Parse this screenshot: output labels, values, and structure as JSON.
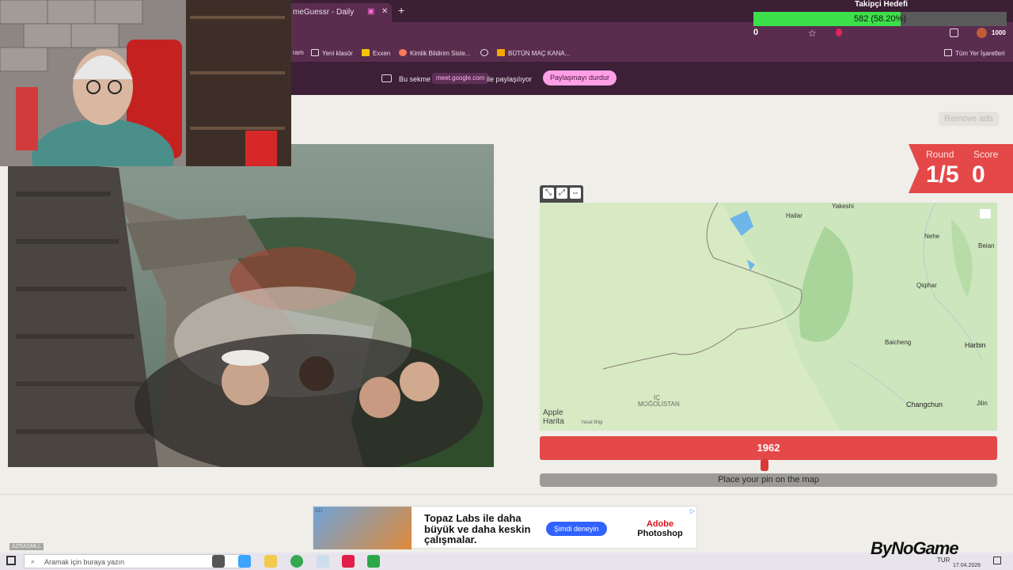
{
  "browser": {
    "tab_title": "meGuessr - Daily",
    "new_tab": "+",
    "bookmarks": [
      {
        "label": "ram",
        "icon": ""
      },
      {
        "label": "Yeni klasör",
        "icon": "folder-icon"
      },
      {
        "label": "Exxen",
        "icon": "exxen-icon"
      },
      {
        "label": "Kimlik Bildirim Siste...",
        "icon": "pencil-icon"
      },
      {
        "label": "",
        "icon": "globe-icon"
      },
      {
        "label": "BÜTÜN MAÇ KANA...",
        "icon": "jp-icon"
      },
      {
        "label": "Tüm Yer İşaretleri",
        "icon": "folder-icon"
      }
    ],
    "share_bar": {
      "text1": "Bu sekme",
      "domain": "meet.google.com",
      "text2": "ile paylaşılıyor",
      "stop_button": "Paylaşmayı durdur"
    }
  },
  "game": {
    "remove_ads": "Remove ads",
    "round_label": "Round",
    "round_value": "1/5",
    "score_label": "Score",
    "score_value": "0",
    "year_value": "1962",
    "year_slider_fraction": 0.49,
    "pin_prompt": "Place your pin on the map",
    "map": {
      "attribution": "Apple",
      "attribution2": "Harita",
      "legal": "Yasal Bilgi",
      "labels": [
        {
          "text": "Yakeshi",
          "kind": "city"
        },
        {
          "text": "Hailar",
          "kind": "city"
        },
        {
          "text": "Nehe",
          "kind": "city"
        },
        {
          "text": "Beian",
          "kind": "city"
        },
        {
          "text": "Qiqihar",
          "kind": "city"
        },
        {
          "text": "Baicheng",
          "kind": "city"
        },
        {
          "text": "Harbin",
          "kind": "city"
        },
        {
          "text": "Changchun",
          "kind": "big"
        },
        {
          "text": "Jilin",
          "kind": "city"
        },
        {
          "text": "İÇ",
          "kind": "region"
        },
        {
          "text": "MOĞOLİSTAN",
          "kind": "region"
        }
      ]
    }
  },
  "ad": {
    "badge": "AD",
    "headline": "Topaz Labs ile daha büyük ve daha keskin çalışmalar.",
    "cta": "Şimdi deneyin",
    "brand_line1": "Adobe",
    "brand_line2": "Photoshop"
  },
  "taskbar": {
    "search_placeholder": "Aramak için buraya yazın",
    "lang": "TUR",
    "date": "17.04.2026"
  },
  "overlay": {
    "follow_title": "Takipçi Hedefi",
    "follow_progress": "582 (58.20%)",
    "follow_fraction": 0.582,
    "follow_min": "0",
    "follow_max": "1000",
    "watermark": "ByNoGame",
    "streamer": "AZRASMLL"
  }
}
